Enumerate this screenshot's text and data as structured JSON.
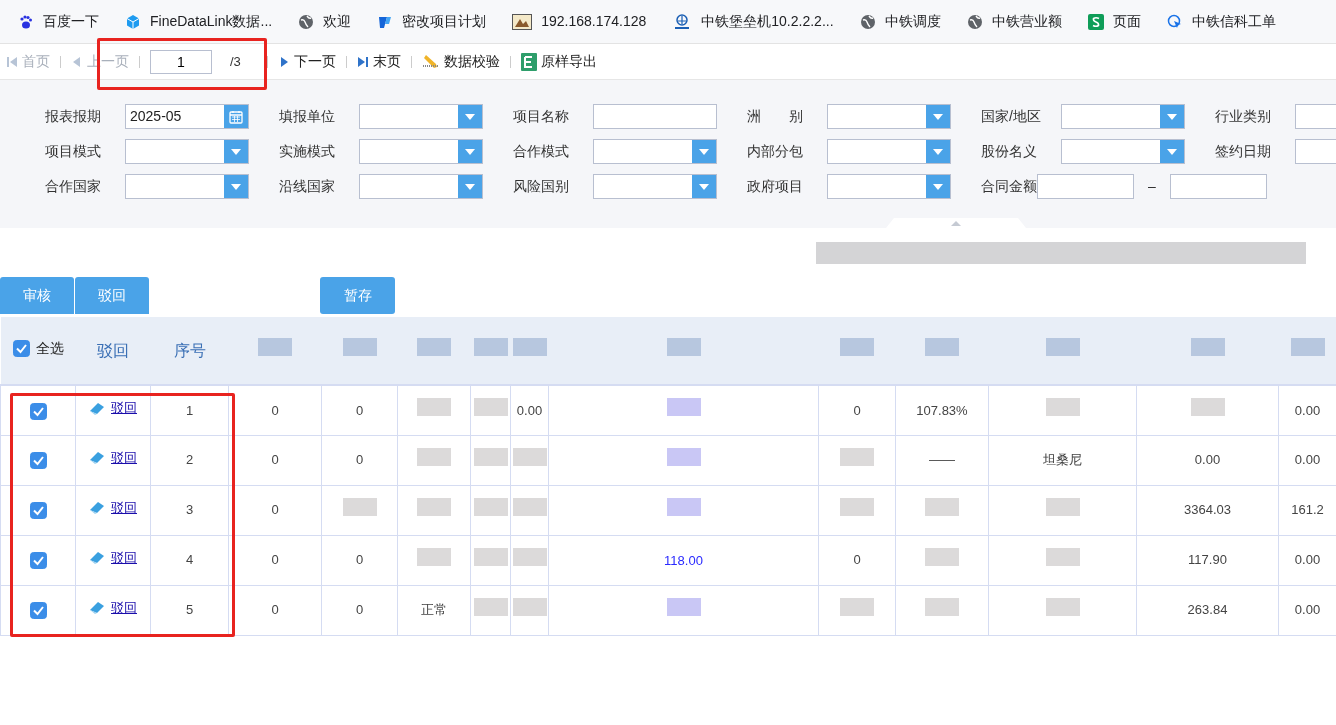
{
  "bookmarks": [
    {
      "label": "百度一下"
    },
    {
      "label": "FineDataLink数据..."
    },
    {
      "label": "欢迎"
    },
    {
      "label": "密改项目计划"
    },
    {
      "label": "192.168.174.128"
    },
    {
      "label": "中铁堡垒机10.2.2.2..."
    },
    {
      "label": "中铁调度"
    },
    {
      "label": "中铁营业额"
    },
    {
      "label": "页面"
    },
    {
      "label": "中铁信科工单"
    }
  ],
  "toolbar": {
    "first": {
      "label": "首页",
      "disabled": true
    },
    "prev": {
      "label": "上一页",
      "disabled": true
    },
    "page": "1",
    "total": "/3",
    "next": {
      "label": "下一页",
      "disabled": false
    },
    "last": {
      "label": "末页",
      "disabled": false
    },
    "check": "数据校验",
    "export": "原样导出"
  },
  "filters": [
    [
      {
        "label": "报表报期",
        "kind": "date",
        "value": "2025-05"
      },
      {
        "label": "填报单位",
        "kind": "select"
      },
      {
        "label": "项目名称",
        "kind": "text"
      },
      {
        "label": "洲　　别",
        "kind": "select"
      },
      {
        "label": "国家/地区",
        "kind": "select"
      },
      {
        "label": "行业类别",
        "kind": "text"
      }
    ],
    [
      {
        "label": "项目模式",
        "kind": "select"
      },
      {
        "label": "实施模式",
        "kind": "select"
      },
      {
        "label": "合作模式",
        "kind": "select"
      },
      {
        "label": "内部分包",
        "kind": "select"
      },
      {
        "label": "股份名义",
        "kind": "select"
      },
      {
        "label": "签约日期",
        "kind": "text"
      }
    ],
    [
      {
        "label": "合作国家",
        "kind": "select"
      },
      {
        "label": "沿线国家",
        "kind": "select"
      },
      {
        "label": "风险国别",
        "kind": "select"
      },
      {
        "label": "政府项目",
        "kind": "select"
      },
      {
        "label": "合同金额",
        "kind": "range",
        "separator": "–"
      }
    ]
  ],
  "actions": {
    "left": [
      "审核",
      "驳回"
    ],
    "right": [
      "暂存"
    ]
  },
  "table": {
    "columns": [
      {
        "kind": "checkbox",
        "label": "全选",
        "checked": true
      },
      {
        "kind": "text",
        "label": "驳回"
      },
      {
        "kind": "text",
        "label": "序号"
      },
      {
        "kind": "blur"
      },
      {
        "kind": "blur"
      },
      {
        "kind": "blur"
      },
      {
        "kind": "blur"
      },
      {
        "kind": "blur"
      },
      {
        "kind": "blur"
      },
      {
        "kind": "blur"
      },
      {
        "kind": "blur"
      },
      {
        "kind": "blur"
      },
      {
        "kind": "blur"
      },
      {
        "kind": "blur"
      }
    ],
    "rows": [
      {
        "checked": true,
        "action": "驳回",
        "seq": "1",
        "cells": [
          {
            "kind": "text",
            "text": "0"
          },
          {
            "kind": "text",
            "text": "0"
          },
          {
            "kind": "blur"
          },
          {
            "kind": "blur"
          },
          {
            "kind": "text",
            "text": "0.00"
          },
          {
            "kind": "blur-link"
          },
          {
            "kind": "text",
            "text": "0"
          },
          {
            "kind": "text",
            "text": "107.83%"
          },
          {
            "kind": "blur"
          },
          {
            "kind": "blur"
          },
          {
            "kind": "text",
            "text": "0.00"
          }
        ]
      },
      {
        "checked": true,
        "action": "驳回",
        "seq": "2",
        "cells": [
          {
            "kind": "text",
            "text": "0"
          },
          {
            "kind": "text",
            "text": "0"
          },
          {
            "kind": "blur"
          },
          {
            "kind": "blur"
          },
          {
            "kind": "blur"
          },
          {
            "kind": "blur-link"
          },
          {
            "kind": "blur"
          },
          {
            "kind": "text",
            "text": "——"
          },
          {
            "kind": "text",
            "text": "坦桑尼"
          },
          {
            "kind": "text",
            "text": "0.00"
          },
          {
            "kind": "text",
            "text": "0.00"
          }
        ]
      },
      {
        "checked": true,
        "action": "驳回",
        "seq": "3",
        "cells": [
          {
            "kind": "text",
            "text": "0"
          },
          {
            "kind": "blur"
          },
          {
            "kind": "blur"
          },
          {
            "kind": "blur"
          },
          {
            "kind": "blur"
          },
          {
            "kind": "blur-link"
          },
          {
            "kind": "blur"
          },
          {
            "kind": "blur"
          },
          {
            "kind": "blur"
          },
          {
            "kind": "text",
            "text": "3364.03"
          },
          {
            "kind": "text",
            "text": "161.2"
          }
        ]
      },
      {
        "checked": true,
        "action": "驳回",
        "seq": "4",
        "cells": [
          {
            "kind": "text",
            "text": "0"
          },
          {
            "kind": "text",
            "text": "0"
          },
          {
            "kind": "blur"
          },
          {
            "kind": "blur"
          },
          {
            "kind": "blur"
          },
          {
            "kind": "link",
            "text": "118.00"
          },
          {
            "kind": "text",
            "text": "0"
          },
          {
            "kind": "blur"
          },
          {
            "kind": "blur"
          },
          {
            "kind": "text",
            "text": "117.90"
          },
          {
            "kind": "text",
            "text": "0.00"
          }
        ]
      },
      {
        "checked": true,
        "action": "驳回",
        "seq": "5",
        "cells": [
          {
            "kind": "text",
            "text": "0"
          },
          {
            "kind": "text",
            "text": "0"
          },
          {
            "kind": "text",
            "text": "正常"
          },
          {
            "kind": "blur"
          },
          {
            "kind": "blur"
          },
          {
            "kind": "blur-link"
          },
          {
            "kind": "blur"
          },
          {
            "kind": "blur"
          },
          {
            "kind": "blur"
          },
          {
            "kind": "text",
            "text": "263.84"
          },
          {
            "kind": "text",
            "text": "0.00"
          }
        ]
      }
    ]
  }
}
